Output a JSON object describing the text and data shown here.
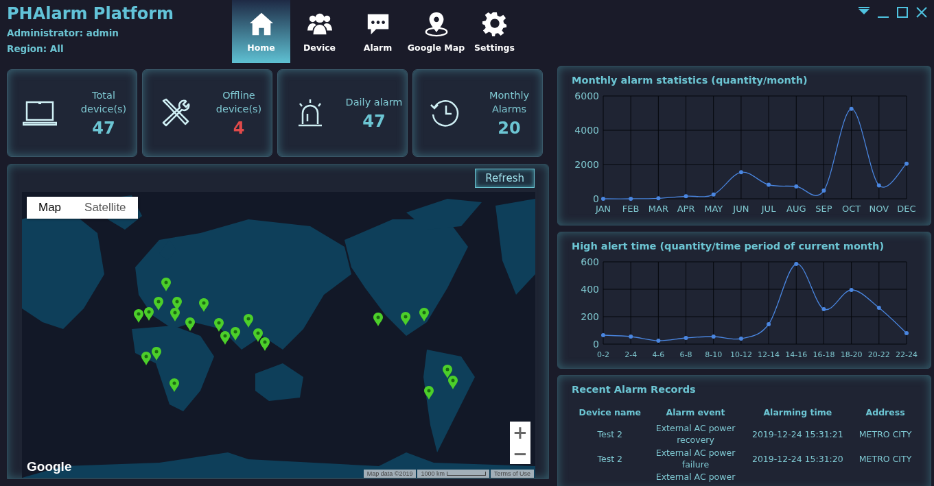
{
  "app": {
    "title": "PHAlarm Platform",
    "administrator": "Administrator: admin",
    "region": "Region: All"
  },
  "nav": [
    {
      "label": "Home",
      "kind": "home",
      "selected": true
    },
    {
      "label": "Device",
      "kind": "users",
      "selected": false
    },
    {
      "label": "Alarm",
      "kind": "chat",
      "selected": false
    },
    {
      "label": "Google Map",
      "kind": "pin",
      "selected": false
    },
    {
      "label": "Settings",
      "kind": "gear",
      "selected": false
    }
  ],
  "stats": [
    {
      "label": "Total device(s)",
      "value": "47",
      "kind": "laptop",
      "warning": false
    },
    {
      "label": "Offline device(s)",
      "value": "4",
      "kind": "tools",
      "warning": true
    },
    {
      "label": "Daily alarm",
      "value": "47",
      "kind": "siren",
      "warning": false
    },
    {
      "label": "Monthly Alarms",
      "value": "20",
      "kind": "history",
      "warning": false
    }
  ],
  "map_panel": {
    "refresh": "Refresh",
    "map_types": [
      {
        "label": "Map",
        "selected": true
      },
      {
        "label": "Satellite",
        "selected": false
      }
    ],
    "zoom_in": "+",
    "zoom_out": "−",
    "logo": "Google",
    "attribution": "Map data ©2019",
    "scale": "1000 km",
    "terms": "Terms of Use"
  },
  "monthly_chart": {
    "title": "Monthly alarm statistics (quantity/month)",
    "chart_data": {
      "type": "line",
      "categories": [
        "JAN",
        "FEB",
        "MAR",
        "APR",
        "MAY",
        "JUN",
        "JUL",
        "AUG",
        "SEP",
        "OCT",
        "NOV",
        "DEC"
      ],
      "series": [
        {
          "color": "#4a86e0",
          "marker": true,
          "values": [
            0,
            0,
            30,
            150,
            250,
            1550,
            820,
            720,
            480,
            5250,
            780,
            2050
          ]
        }
      ],
      "ylim": [
        0,
        6000
      ],
      "yticks": [
        0,
        2000,
        4000,
        6000
      ],
      "grid": true
    }
  },
  "hourly_chart": {
    "title": "High alert time (quantity/time period of current month)",
    "chart_data": {
      "type": "line",
      "categories": [
        "0-2",
        "2-4",
        "4-6",
        "6-8",
        "8-10",
        "10-12",
        "12-14",
        "14-16",
        "16-18",
        "18-20",
        "20-22",
        "22-24"
      ],
      "series": [
        {
          "color": "#4a86e0",
          "marker": true,
          "values": [
            65,
            55,
            25,
            45,
            55,
            40,
            145,
            585,
            255,
            395,
            265,
            80
          ]
        }
      ],
      "ylim": [
        0,
        600
      ],
      "yticks": [
        0,
        200,
        400,
        600
      ],
      "grid": true
    }
  },
  "records": {
    "title": "Recent Alarm Records",
    "columns": [
      "Device name",
      "Alarm event",
      "Alarming time",
      "Address"
    ],
    "rows": [
      {
        "device": "Test 2",
        "event": "External AC power recovery",
        "time": "2019-12-24 15:31:21",
        "address": "METRO CITY"
      },
      {
        "device": "Test 2",
        "event": "External AC power failure",
        "time": "2019-12-24 15:31:20",
        "address": "METRO CITY"
      },
      {
        "event": "External AC power"
      }
    ]
  }
}
